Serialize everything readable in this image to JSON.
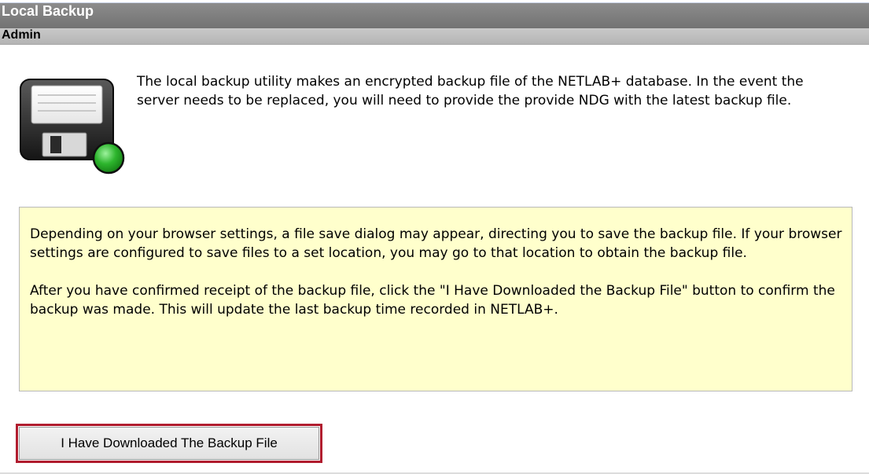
{
  "header": {
    "title": "Local Backup",
    "subtitle": "Admin"
  },
  "intro": {
    "icon": "floppy-disk-icon",
    "text": "The local backup utility makes an encrypted backup file of the NETLAB+ database. In the event the server needs to be replaced, you will need to provide the provide NDG with the latest backup file."
  },
  "notice": {
    "paragraph1": "Depending on your browser settings, a file save dialog may appear, directing you to save the backup file. If your browser settings are configured to save files to a set location, you may go to that location to obtain the backup file.",
    "paragraph2": "After you have confirmed receipt of the backup file, click the \"I Have Downloaded the Backup File\" button to confirm the backup was made. This will update the last backup time recorded in NETLAB+."
  },
  "actions": {
    "confirm_label": "I Have Downloaded The Backup File"
  },
  "colors": {
    "title_bar": "#7f7f7f",
    "subtitle_bar": "#bfbfbf",
    "notice_background": "#ffffcc",
    "highlight_border": "#b01c2e",
    "status_green": "#2db52d"
  }
}
